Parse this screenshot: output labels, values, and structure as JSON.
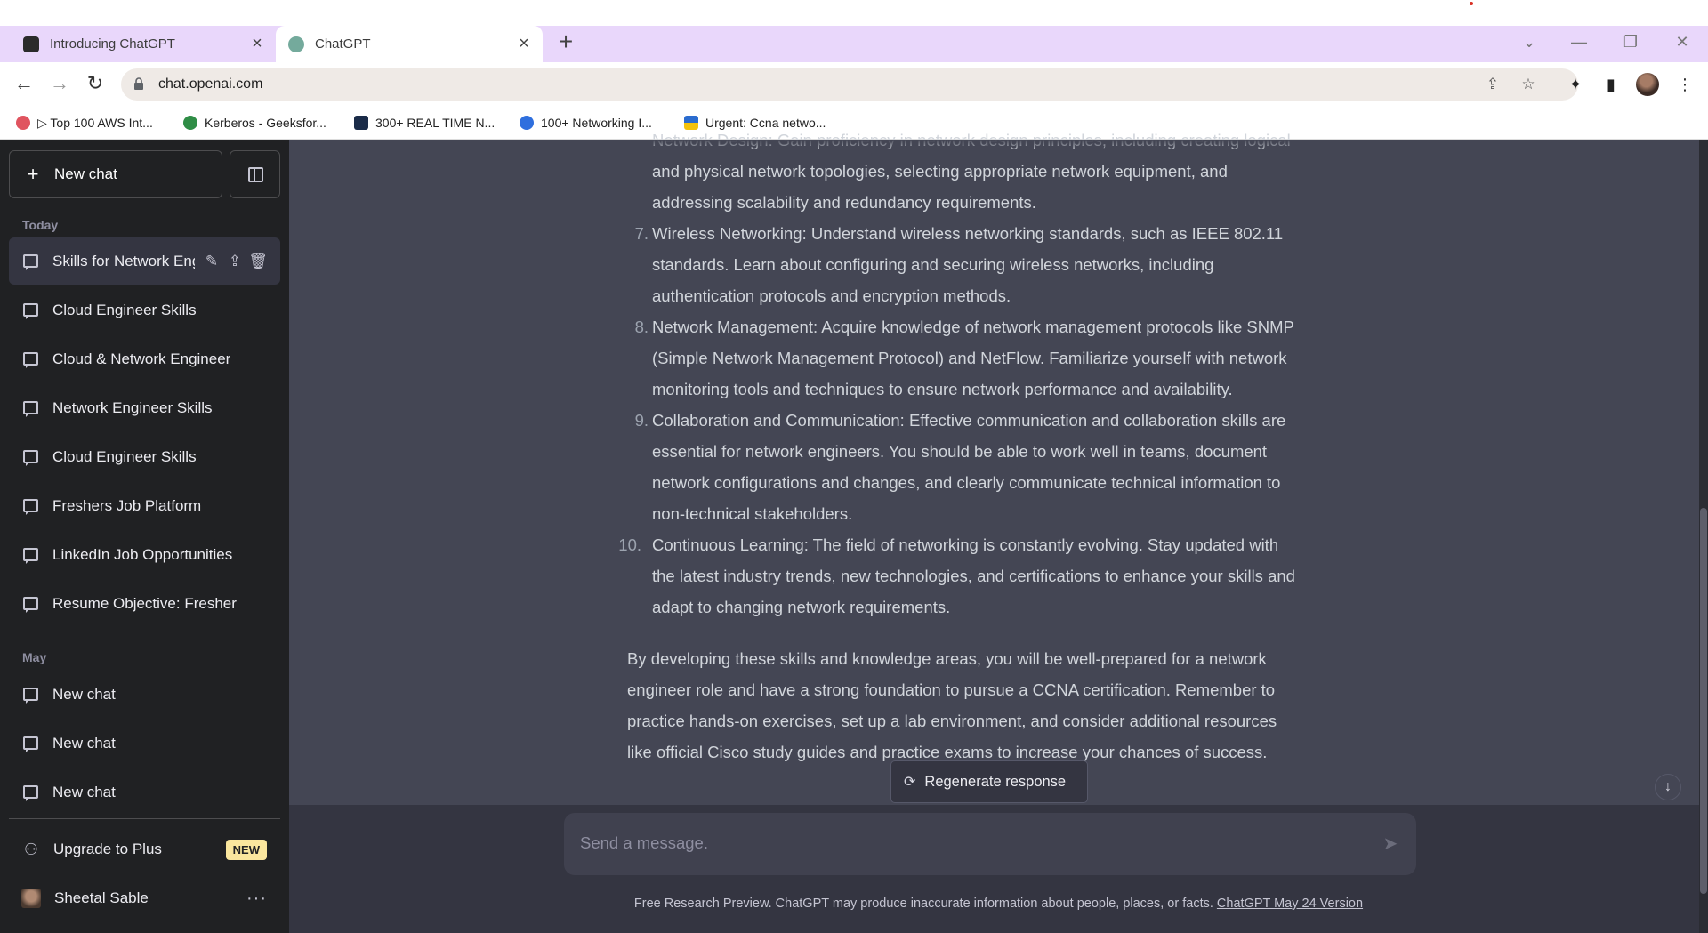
{
  "browser": {
    "tabs": [
      {
        "title": "Introducing ChatGPT",
        "active": false
      },
      {
        "title": "ChatGPT",
        "active": true
      }
    ],
    "url": "chat.openai.com",
    "bookmarks": [
      "▷ Top 100 AWS Int...",
      "Kerberos - Geeksfor...",
      "300+ REAL TIME N...",
      "100+ Networking I...",
      "Urgent: Ccna netwo..."
    ]
  },
  "sidebar": {
    "new_chat": "New chat",
    "today_label": "Today",
    "today": [
      "Skills for Network Engineer",
      "Cloud Engineer Skills",
      "Cloud & Network Engineer",
      "Network Engineer Skills",
      "Cloud Engineer Skills",
      "Freshers Job Platform",
      "LinkedIn Job Opportunities",
      "Resume Objective: Fresher"
    ],
    "may_label": "May",
    "may": [
      "New chat",
      "New chat",
      "New chat"
    ],
    "upgrade": "Upgrade to Plus",
    "badge": "NEW",
    "user": "Sheetal Sable"
  },
  "conversation": {
    "partial_first_line": "Network Design: Gain proficiency in network design principles, including creating logical",
    "items": [
      {
        "num": "",
        "lines": [
          "and physical network topologies, selecting appropriate network equipment, and",
          "addressing scalability and redundancy requirements."
        ]
      },
      {
        "num": "7.",
        "lines": [
          "Wireless Networking: Understand wireless networking standards, such as IEEE 802.11",
          "standards. Learn about configuring and securing wireless networks, including",
          "authentication protocols and encryption methods."
        ]
      },
      {
        "num": "8.",
        "lines": [
          "Network Management: Acquire knowledge of network management protocols like SNMP",
          "(Simple Network Management Protocol) and NetFlow. Familiarize yourself with network",
          "monitoring tools and techniques to ensure network performance and availability."
        ]
      },
      {
        "num": "9.",
        "lines": [
          "Collaboration and Communication: Effective communication and collaboration skills are",
          "essential for network engineers. You should be able to work well in teams, document",
          "network configurations and changes, and clearly communicate technical information to",
          "non-technical stakeholders."
        ]
      },
      {
        "num": "10.",
        "lines": [
          "Continuous Learning: The field of networking is constantly evolving. Stay updated with",
          "the latest industry trends, new technologies, and certifications to enhance your skills and",
          "adapt to changing network requirements."
        ]
      }
    ],
    "closing": [
      "By developing these skills and knowledge areas, you will be well-prepared for a network",
      "engineer role and have a strong foundation to pursue a CCNA certification. Remember to",
      "practice hands-on exercises, set up a lab environment, and consider additional resources",
      "like official Cisco study guides and practice exams to increase your chances of success."
    ]
  },
  "regenerate": "Regenerate response",
  "composer": {
    "placeholder": "Send a message."
  },
  "footer": {
    "text": "Free Research Preview. ChatGPT may produce inaccurate information about people, places, or facts. ",
    "link": "ChatGPT May 24 Version"
  },
  "icons": {
    "send": "send-icon",
    "regenerate": "refresh-icon",
    "scroll": "arrow-down-icon"
  }
}
